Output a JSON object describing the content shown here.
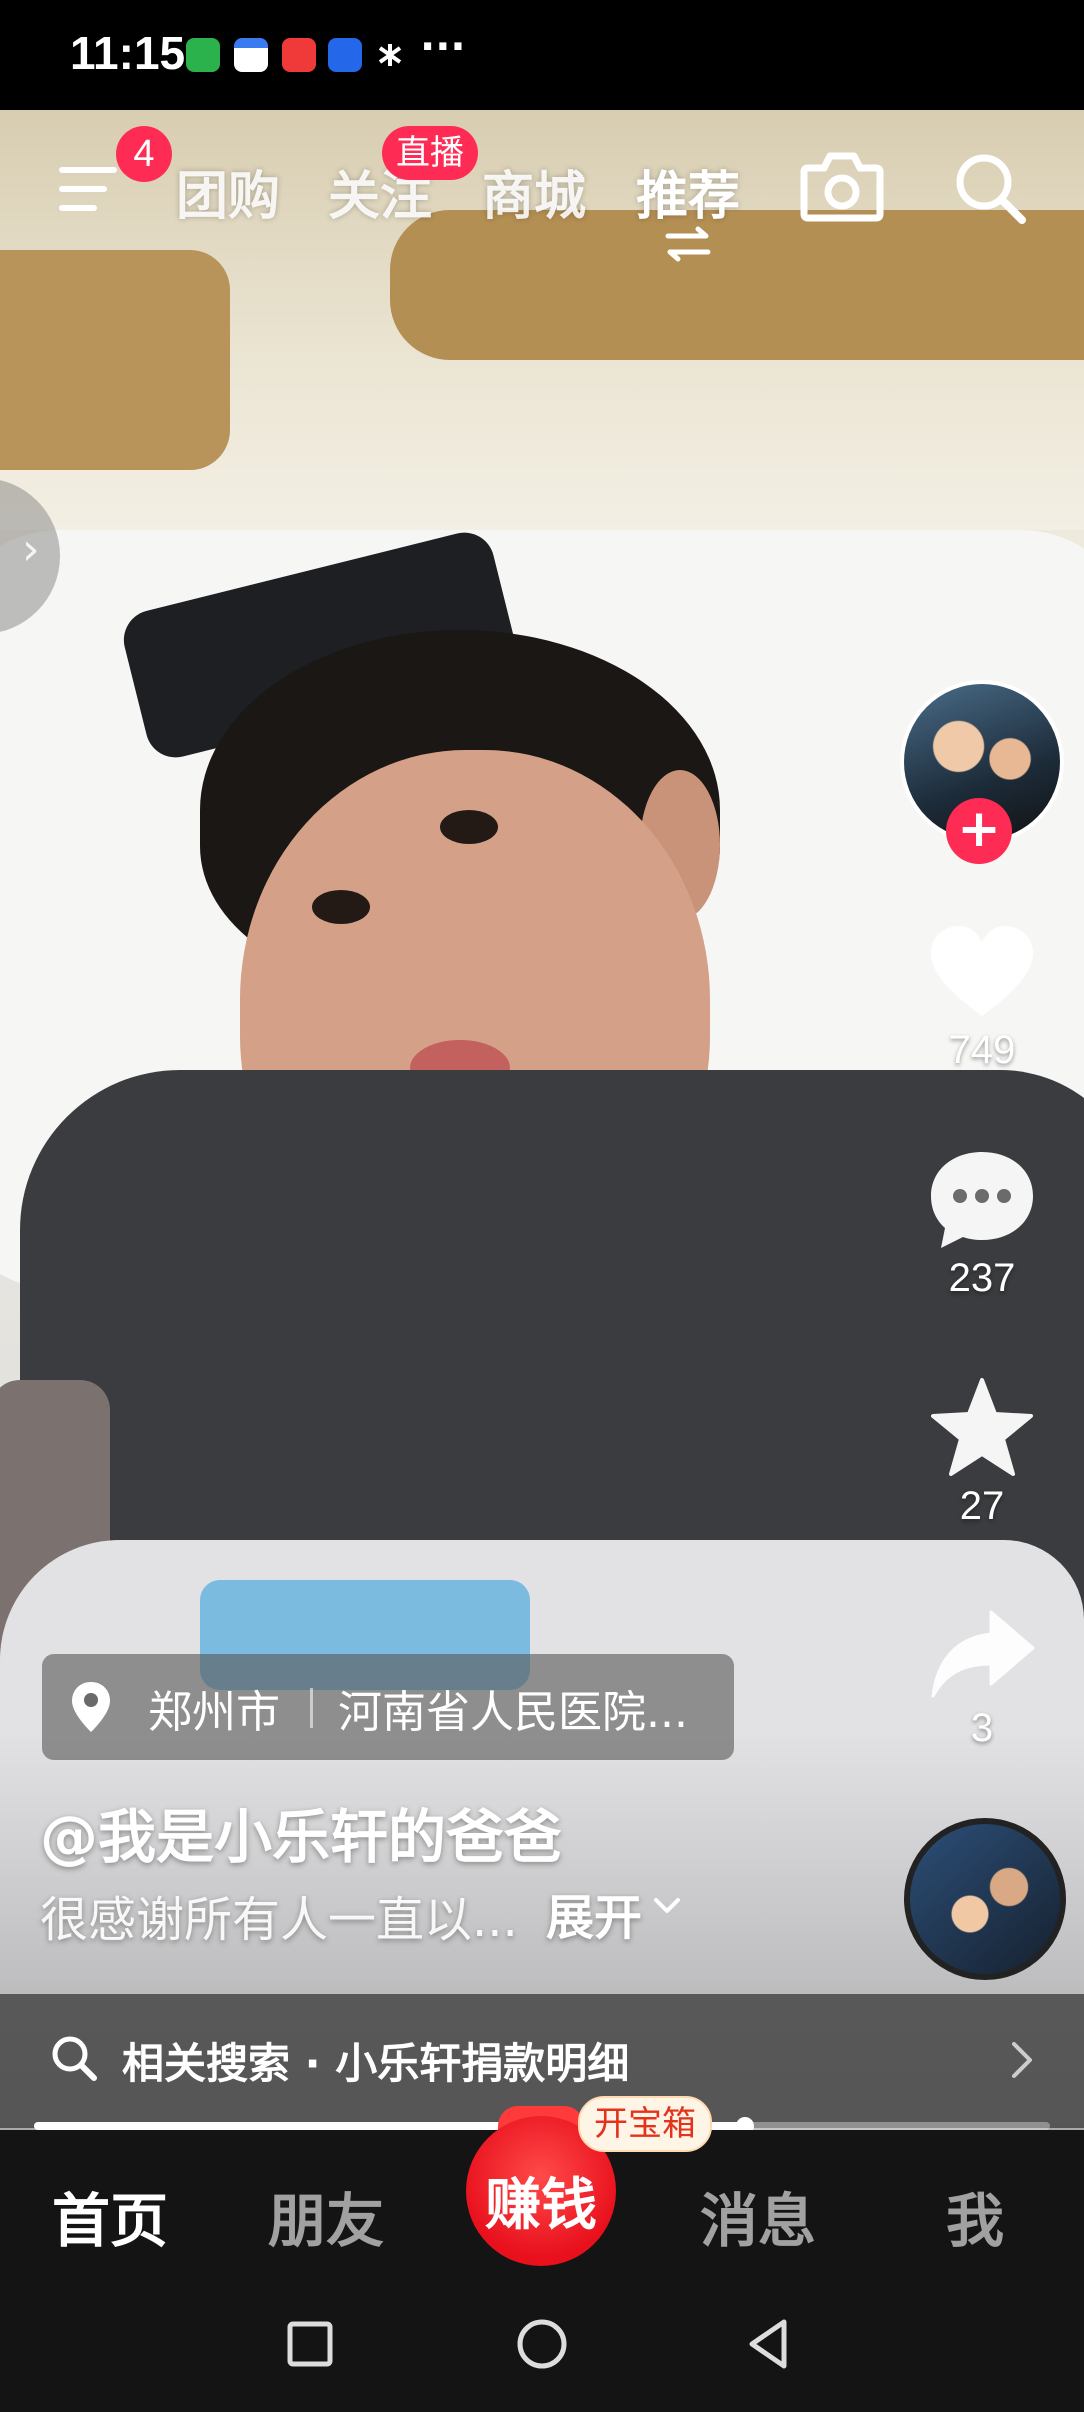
{
  "status_bar": {
    "time": "11:15",
    "more": "···"
  },
  "top_nav": {
    "menu_badge": "4",
    "tabs": [
      {
        "label": "团购"
      },
      {
        "label": "关注",
        "badge": "直播"
      },
      {
        "label": "商城"
      },
      {
        "label": "推荐",
        "active": true
      }
    ]
  },
  "right_rail": {
    "likes": "749",
    "comments": "237",
    "favorites": "27",
    "shares": "3"
  },
  "video_info": {
    "location_city": "郑州市",
    "location_place": "河南省人民医院...",
    "author": "@我是小乐轩的爸爸",
    "caption": "很感谢所有人一直以...",
    "expand_label": "展开"
  },
  "related_search": {
    "label": "相关搜索 · 小乐轩捐款明细"
  },
  "playback": {
    "progress_fraction": 0.7
  },
  "tab_bar": {
    "home": "首页",
    "friends": "朋友",
    "earn": "赚钱",
    "earn_badge": "开宝箱",
    "messages": "消息",
    "me": "我"
  },
  "colors": {
    "accent_red": "#fe2c55",
    "tabbar_bg": "#141414"
  }
}
